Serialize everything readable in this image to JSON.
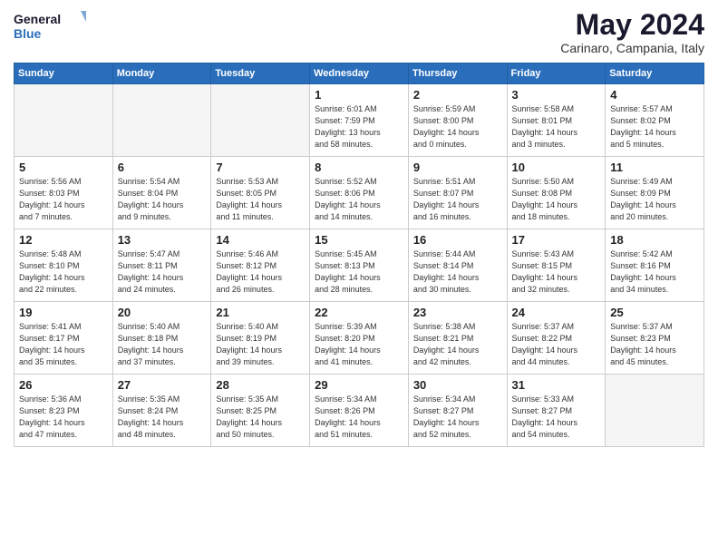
{
  "header": {
    "logo_line1": "General",
    "logo_line2": "Blue",
    "month": "May 2024",
    "location": "Carinaro, Campania, Italy"
  },
  "weekdays": [
    "Sunday",
    "Monday",
    "Tuesday",
    "Wednesday",
    "Thursday",
    "Friday",
    "Saturday"
  ],
  "weeks": [
    [
      {
        "day": "",
        "info": ""
      },
      {
        "day": "",
        "info": ""
      },
      {
        "day": "",
        "info": ""
      },
      {
        "day": "1",
        "info": "Sunrise: 6:01 AM\nSunset: 7:59 PM\nDaylight: 13 hours\nand 58 minutes."
      },
      {
        "day": "2",
        "info": "Sunrise: 5:59 AM\nSunset: 8:00 PM\nDaylight: 14 hours\nand 0 minutes."
      },
      {
        "day": "3",
        "info": "Sunrise: 5:58 AM\nSunset: 8:01 PM\nDaylight: 14 hours\nand 3 minutes."
      },
      {
        "day": "4",
        "info": "Sunrise: 5:57 AM\nSunset: 8:02 PM\nDaylight: 14 hours\nand 5 minutes."
      }
    ],
    [
      {
        "day": "5",
        "info": "Sunrise: 5:56 AM\nSunset: 8:03 PM\nDaylight: 14 hours\nand 7 minutes."
      },
      {
        "day": "6",
        "info": "Sunrise: 5:54 AM\nSunset: 8:04 PM\nDaylight: 14 hours\nand 9 minutes."
      },
      {
        "day": "7",
        "info": "Sunrise: 5:53 AM\nSunset: 8:05 PM\nDaylight: 14 hours\nand 11 minutes."
      },
      {
        "day": "8",
        "info": "Sunrise: 5:52 AM\nSunset: 8:06 PM\nDaylight: 14 hours\nand 14 minutes."
      },
      {
        "day": "9",
        "info": "Sunrise: 5:51 AM\nSunset: 8:07 PM\nDaylight: 14 hours\nand 16 minutes."
      },
      {
        "day": "10",
        "info": "Sunrise: 5:50 AM\nSunset: 8:08 PM\nDaylight: 14 hours\nand 18 minutes."
      },
      {
        "day": "11",
        "info": "Sunrise: 5:49 AM\nSunset: 8:09 PM\nDaylight: 14 hours\nand 20 minutes."
      }
    ],
    [
      {
        "day": "12",
        "info": "Sunrise: 5:48 AM\nSunset: 8:10 PM\nDaylight: 14 hours\nand 22 minutes."
      },
      {
        "day": "13",
        "info": "Sunrise: 5:47 AM\nSunset: 8:11 PM\nDaylight: 14 hours\nand 24 minutes."
      },
      {
        "day": "14",
        "info": "Sunrise: 5:46 AM\nSunset: 8:12 PM\nDaylight: 14 hours\nand 26 minutes."
      },
      {
        "day": "15",
        "info": "Sunrise: 5:45 AM\nSunset: 8:13 PM\nDaylight: 14 hours\nand 28 minutes."
      },
      {
        "day": "16",
        "info": "Sunrise: 5:44 AM\nSunset: 8:14 PM\nDaylight: 14 hours\nand 30 minutes."
      },
      {
        "day": "17",
        "info": "Sunrise: 5:43 AM\nSunset: 8:15 PM\nDaylight: 14 hours\nand 32 minutes."
      },
      {
        "day": "18",
        "info": "Sunrise: 5:42 AM\nSunset: 8:16 PM\nDaylight: 14 hours\nand 34 minutes."
      }
    ],
    [
      {
        "day": "19",
        "info": "Sunrise: 5:41 AM\nSunset: 8:17 PM\nDaylight: 14 hours\nand 35 minutes."
      },
      {
        "day": "20",
        "info": "Sunrise: 5:40 AM\nSunset: 8:18 PM\nDaylight: 14 hours\nand 37 minutes."
      },
      {
        "day": "21",
        "info": "Sunrise: 5:40 AM\nSunset: 8:19 PM\nDaylight: 14 hours\nand 39 minutes."
      },
      {
        "day": "22",
        "info": "Sunrise: 5:39 AM\nSunset: 8:20 PM\nDaylight: 14 hours\nand 41 minutes."
      },
      {
        "day": "23",
        "info": "Sunrise: 5:38 AM\nSunset: 8:21 PM\nDaylight: 14 hours\nand 42 minutes."
      },
      {
        "day": "24",
        "info": "Sunrise: 5:37 AM\nSunset: 8:22 PM\nDaylight: 14 hours\nand 44 minutes."
      },
      {
        "day": "25",
        "info": "Sunrise: 5:37 AM\nSunset: 8:23 PM\nDaylight: 14 hours\nand 45 minutes."
      }
    ],
    [
      {
        "day": "26",
        "info": "Sunrise: 5:36 AM\nSunset: 8:23 PM\nDaylight: 14 hours\nand 47 minutes."
      },
      {
        "day": "27",
        "info": "Sunrise: 5:35 AM\nSunset: 8:24 PM\nDaylight: 14 hours\nand 48 minutes."
      },
      {
        "day": "28",
        "info": "Sunrise: 5:35 AM\nSunset: 8:25 PM\nDaylight: 14 hours\nand 50 minutes."
      },
      {
        "day": "29",
        "info": "Sunrise: 5:34 AM\nSunset: 8:26 PM\nDaylight: 14 hours\nand 51 minutes."
      },
      {
        "day": "30",
        "info": "Sunrise: 5:34 AM\nSunset: 8:27 PM\nDaylight: 14 hours\nand 52 minutes."
      },
      {
        "day": "31",
        "info": "Sunrise: 5:33 AM\nSunset: 8:27 PM\nDaylight: 14 hours\nand 54 minutes."
      },
      {
        "day": "",
        "info": ""
      }
    ]
  ]
}
